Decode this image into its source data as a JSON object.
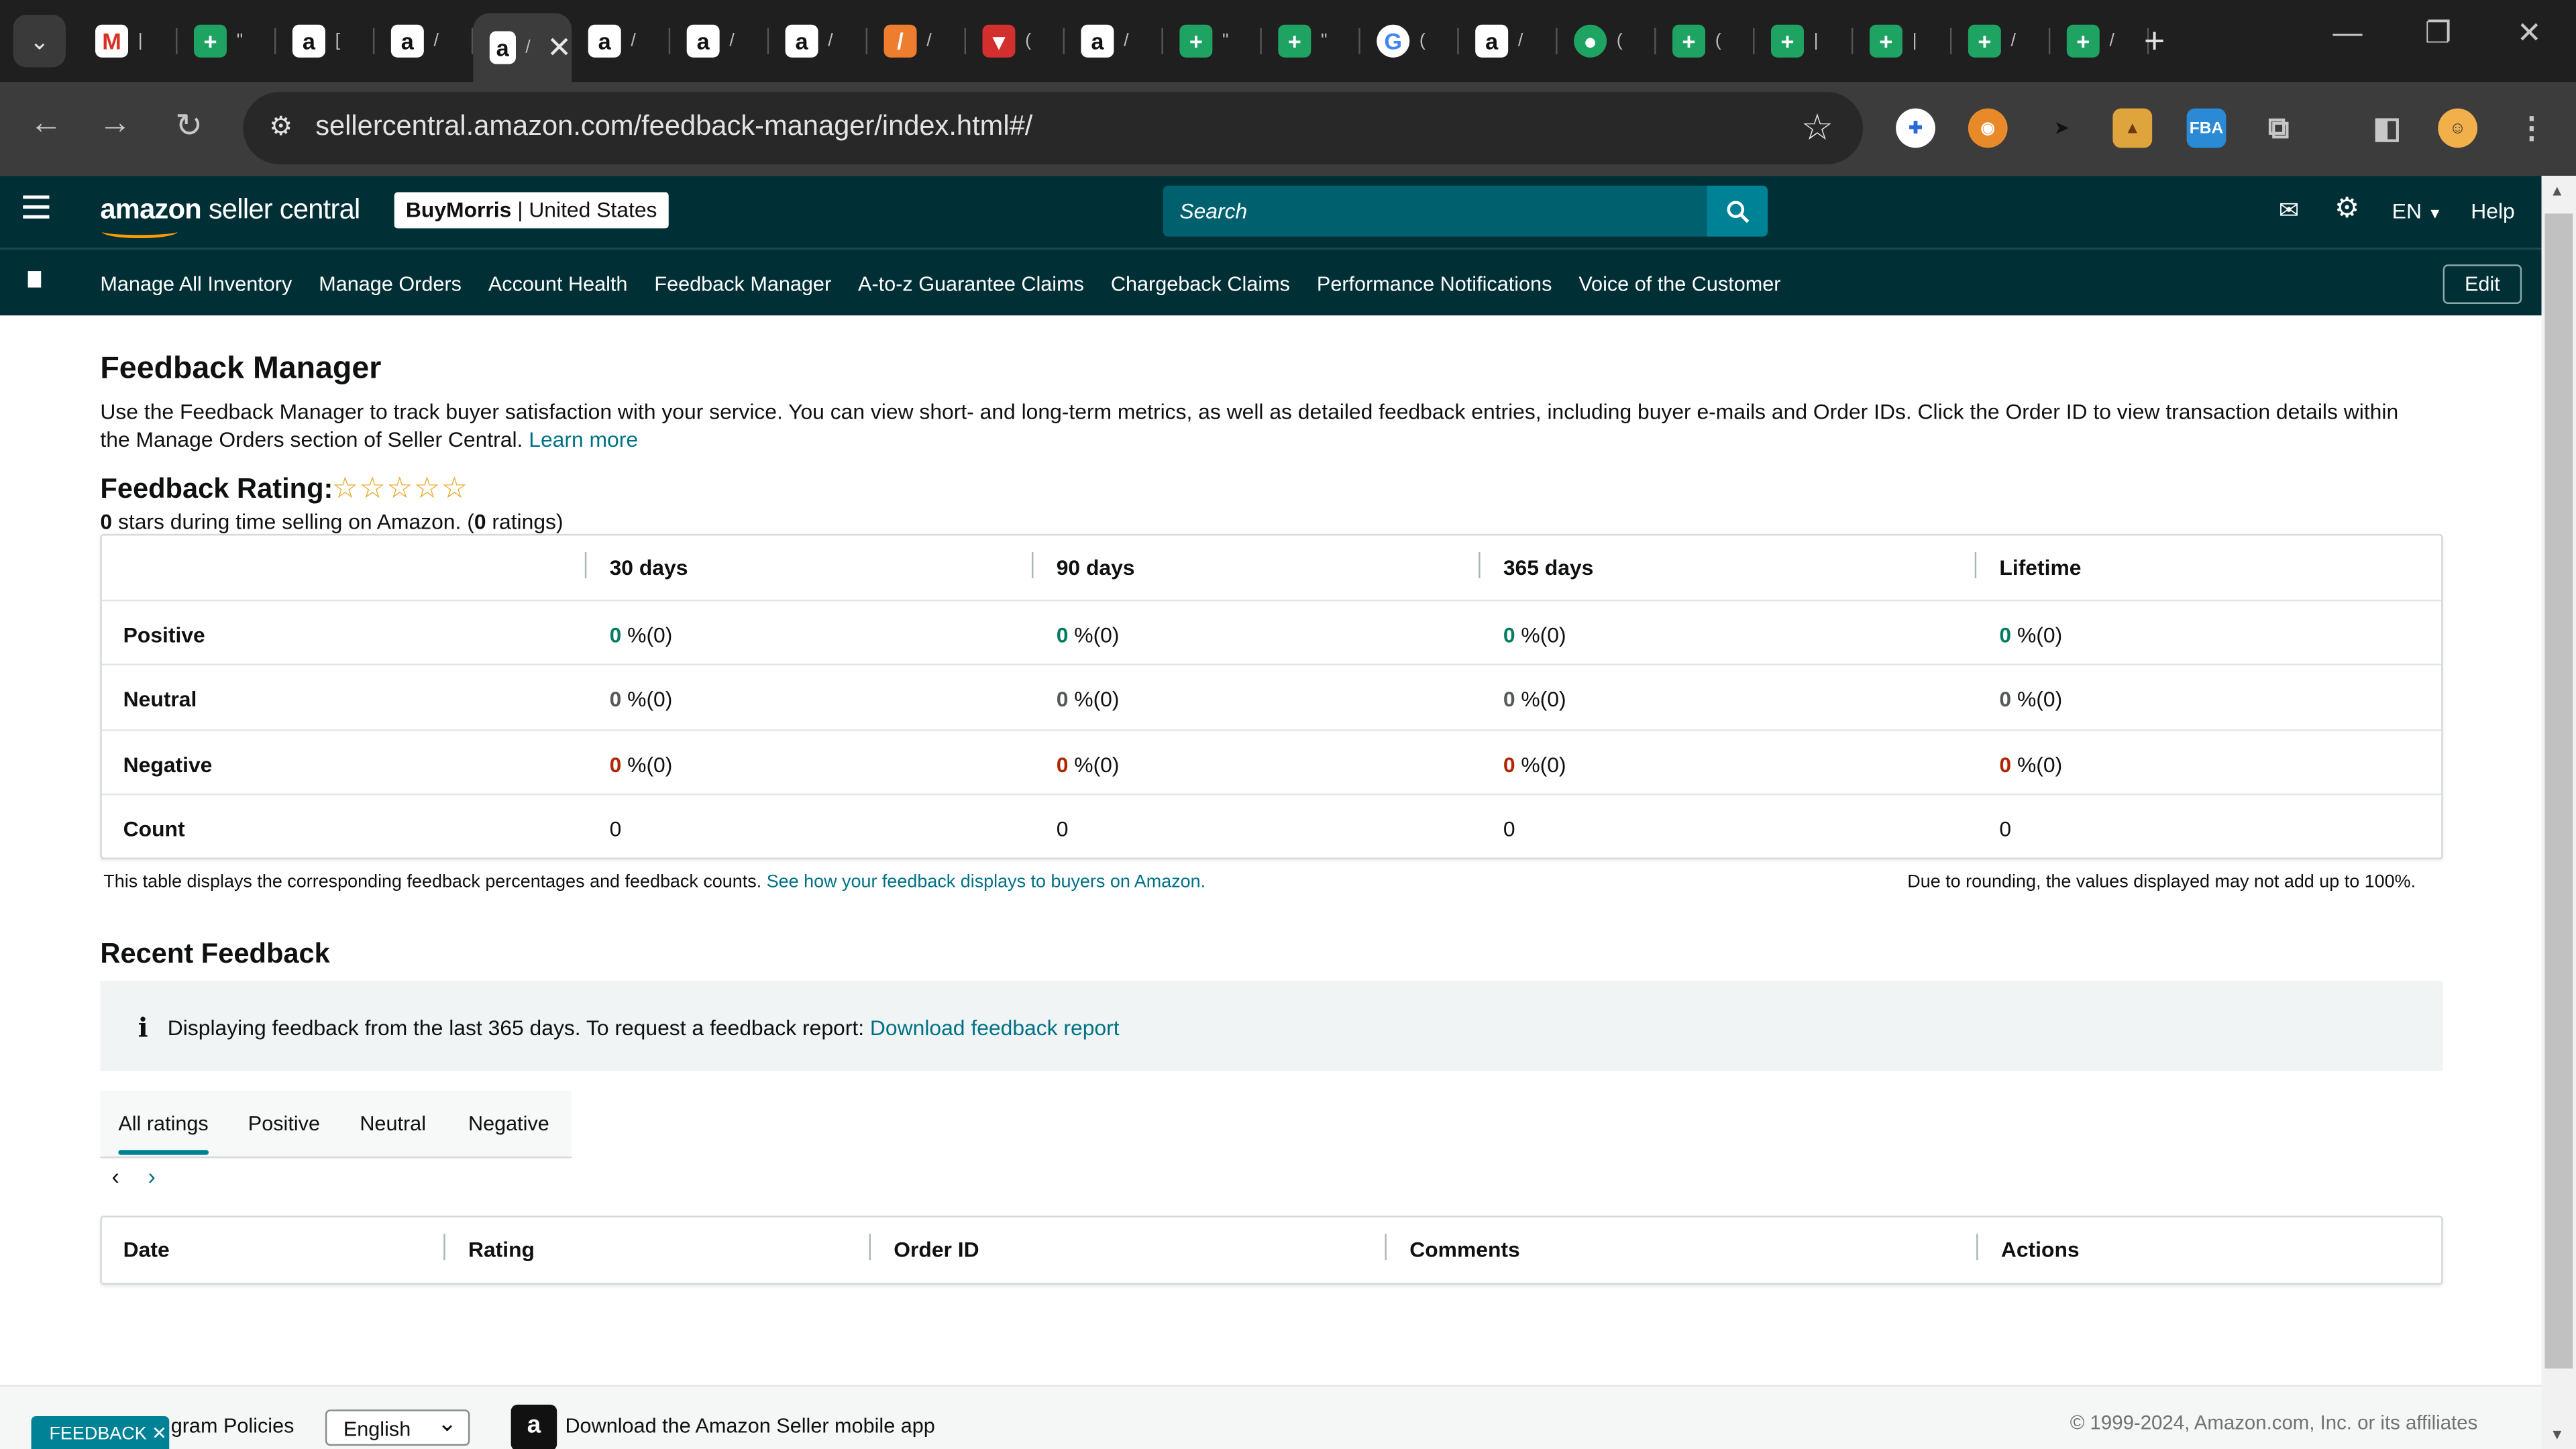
{
  "browser": {
    "tabs": [
      {
        "icon": "gmail-icon",
        "glyph": "M",
        "cls": "fav-gmail",
        "mark": "|"
      },
      {
        "icon": "sheets-icon",
        "glyph": "+",
        "cls": "fav-sheet",
        "mark": "\""
      },
      {
        "icon": "amazon-icon",
        "glyph": "a",
        "cls": "fav-amz",
        "mark": "["
      },
      {
        "icon": "amazon-icon",
        "glyph": "a",
        "cls": "fav-amz",
        "mark": "/"
      },
      {
        "icon": "amazon-icon",
        "glyph": "a",
        "cls": "fav-amz",
        "mark": "/",
        "active": true
      },
      {
        "icon": "amazon-icon",
        "glyph": "a",
        "cls": "fav-amz",
        "mark": "/"
      },
      {
        "icon": "amazon-icon",
        "glyph": "a",
        "cls": "fav-amz",
        "mark": "/"
      },
      {
        "icon": "amazon-icon",
        "glyph": "a",
        "cls": "fav-amz",
        "mark": "/"
      },
      {
        "icon": "pencil-tool-icon",
        "glyph": "/",
        "cls": "fav-slash",
        "mark": "/"
      },
      {
        "icon": "red-logo-icon",
        "glyph": "▾",
        "cls": "fav-red",
        "mark": "("
      },
      {
        "icon": "amazon-icon",
        "glyph": "a",
        "cls": "fav-amz",
        "mark": "/"
      },
      {
        "icon": "sheets-icon",
        "glyph": "+",
        "cls": "fav-sheet",
        "mark": "\""
      },
      {
        "icon": "sheets-icon",
        "glyph": "+",
        "cls": "fav-sheet",
        "mark": "\""
      },
      {
        "icon": "google-icon",
        "glyph": "G",
        "cls": "fav-google",
        "mark": "("
      },
      {
        "icon": "amazon-icon",
        "glyph": "a",
        "cls": "fav-amz",
        "mark": "/"
      },
      {
        "icon": "green-circle-icon",
        "glyph": "●",
        "cls": "fav-green",
        "mark": "("
      },
      {
        "icon": "sheets-icon",
        "glyph": "+",
        "cls": "fav-sheet",
        "mark": "("
      },
      {
        "icon": "sheets-icon",
        "glyph": "+",
        "cls": "fav-sheet",
        "mark": "|"
      },
      {
        "icon": "sheets-icon",
        "glyph": "+",
        "cls": "fav-sheet",
        "mark": "|"
      },
      {
        "icon": "sheets-icon",
        "glyph": "+",
        "cls": "fav-sheet",
        "mark": "/"
      },
      {
        "icon": "sheets-icon",
        "glyph": "+",
        "cls": "fav-sheet",
        "mark": "/"
      }
    ],
    "url": "sellercentral.amazon.com/feedback-manager/index.html#/",
    "extensions": [
      "FBA"
    ]
  },
  "header": {
    "logo_main": "amazon",
    "logo_sub": " seller central",
    "account_store": "BuyMorris",
    "account_region": " | United States",
    "search_placeholder": "Search",
    "language": "EN",
    "help": "Help"
  },
  "nav": {
    "links": [
      "Manage All Inventory",
      "Manage Orders",
      "Account Health",
      "Feedback Manager",
      "A-to-z Guarantee Claims",
      "Chargeback Claims",
      "Performance Notifications",
      "Voice of the Customer"
    ],
    "edit": "Edit"
  },
  "main": {
    "title": "Feedback Manager",
    "intro": "Use the Feedback Manager to track buyer satisfaction with your service. You can view short- and long-term metrics, as well as detailed feedback entries, including buyer e-mails and Order IDs. Click the Order ID to view transaction details within the Manage Orders section of Seller Central.",
    "learn_more": "Learn more",
    "rating_label": "Feedback Rating:",
    "stars_display": "☆☆☆☆☆",
    "star_rating": 0,
    "rating_stars_value": "0",
    "rating_sub_1": " stars during time selling on Amazon. (",
    "rating_count": "0",
    "rating_sub_2": " ratings)",
    "table": {
      "columns": [
        "30 days",
        "90 days",
        "365 days",
        "Lifetime"
      ],
      "rows": [
        {
          "label": "Positive",
          "kind": "pos",
          "values": [
            [
              "0",
              " %(0)"
            ],
            [
              "0",
              " %(0)"
            ],
            [
              "0",
              " %(0)"
            ],
            [
              "0",
              " %(0)"
            ]
          ]
        },
        {
          "label": "Neutral",
          "kind": "neu",
          "values": [
            [
              "0",
              " %(0)"
            ],
            [
              "0",
              " %(0)"
            ],
            [
              "0",
              " %(0)"
            ],
            [
              "0",
              " %(0)"
            ]
          ]
        },
        {
          "label": "Negative",
          "kind": "neg",
          "values": [
            [
              "0",
              " %(0)"
            ],
            [
              "0",
              " %(0)"
            ],
            [
              "0",
              " %(0)"
            ],
            [
              "0",
              " %(0)"
            ]
          ]
        },
        {
          "label": "Count",
          "kind": "count",
          "values": [
            [
              "0",
              ""
            ],
            [
              "0",
              ""
            ],
            [
              "0",
              ""
            ],
            [
              "0",
              ""
            ]
          ]
        }
      ]
    },
    "note_left": "This table displays the corresponding feedback percentages and feedback counts.",
    "note_link": "See how your feedback displays to buyers on Amazon.",
    "note_right": "Due to rounding, the values displayed may not add up to 100%.",
    "recent_title": "Recent Feedback",
    "info_text": "Displaying feedback from the last 365 days. To request a feedback report:",
    "info_link": "Download feedback report",
    "filter_tabs": [
      "All ratings",
      "Positive",
      "Neutral",
      "Negative"
    ],
    "feedback_columns": [
      "Date",
      "Rating",
      "Order ID",
      "Comments",
      "Actions"
    ]
  },
  "footer": {
    "feedback_tab": "FEEDBACK",
    "policies": "gram Policies",
    "language": "English",
    "app_text": "Download the Amazon Seller mobile app",
    "copyright": "© 1999-2024, Amazon.com, Inc. or its affiliates"
  },
  "colors": {
    "header_bg": "#002f36",
    "accent": "#008296",
    "link": "#007185",
    "positive": "#067d62",
    "negative": "#b12704",
    "star": "#e7a523"
  }
}
